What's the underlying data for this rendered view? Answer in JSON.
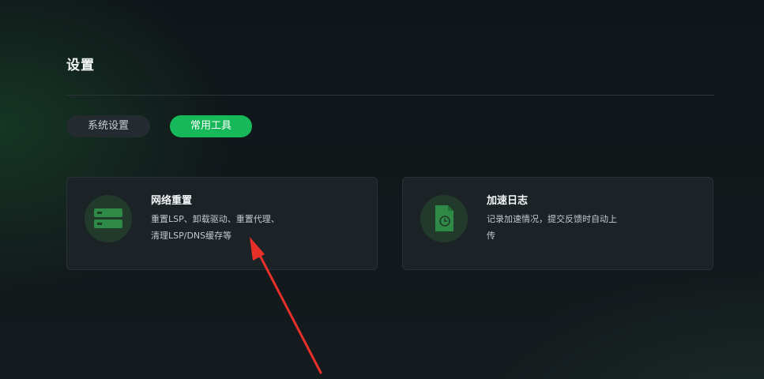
{
  "page": {
    "title": "设置"
  },
  "tabs": [
    {
      "label": "系统设置",
      "active": false
    },
    {
      "label": "常用工具",
      "active": true
    }
  ],
  "cards": [
    {
      "title": "网络重置",
      "desc_lines": [
        "重置LSP、卸载驱动、重置代理、",
        "清理LSP/DNS缓存等"
      ],
      "icon": "server-stack-icon"
    },
    {
      "title": "加速日志",
      "desc_lines": [
        "记录加速情况，提交反馈时自动上",
        "传"
      ],
      "icon": "document-icon"
    }
  ],
  "colors": {
    "accent": "#16b85a",
    "background": "#12181b",
    "card": "#1c2327",
    "icon_circle": "#223a2c",
    "icon_green": "#2f8a47",
    "annotation_arrow": "#e8302a"
  }
}
